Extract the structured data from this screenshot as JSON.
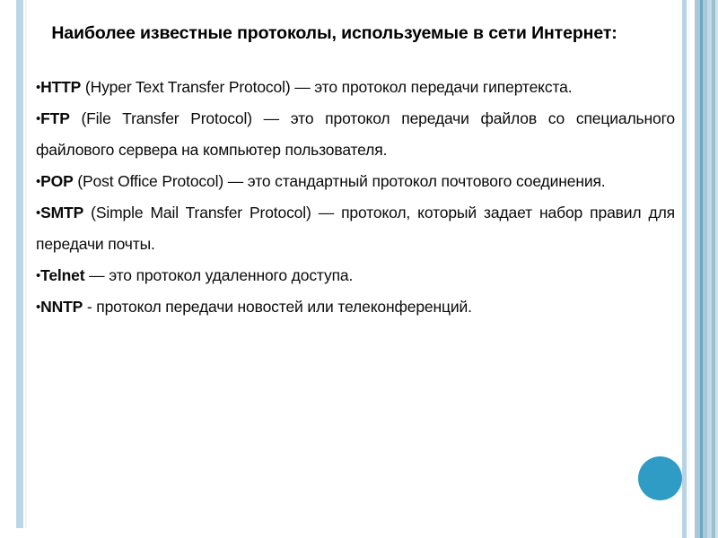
{
  "slide": {
    "title": "Наиболее известные протоколы, используемые в сети Интернет:",
    "bullet_char": "•",
    "background_color": "#ffffff",
    "decor": {
      "left_stripe_color": "#bcd6e8",
      "right_band_colors": [
        "#b9d3e2",
        "#f7fbfd",
        "#a9c7d8",
        "#6da7bf",
        "#a9c8d9",
        "#c3dae7",
        "#9dbfd2",
        "#cfe2ec"
      ],
      "circle_color": "#2e9cc4"
    }
  },
  "protocols": [
    {
      "name": "HTTP",
      "expansion": "(Hyper Text Transfer Protocol)",
      "description": " — это протокол передачи гипертекста.",
      "justify": true
    },
    {
      "name": "FTP",
      "expansion": "(File Transfer Protocol)",
      "description": " — это протокол передачи файлов со специального файлового сервера на компьютер пользователя.",
      "justify": true
    },
    {
      "name": "POP",
      "expansion": "(Post Office Protocol)",
      "description": " — это стандартный протокол почтового соединения.",
      "justify": true
    },
    {
      "name": "SMTP",
      "expansion": "(Simple Mail Transfer Protocol)",
      "description": " — протокол, который задает набор правил для передачи почты.",
      "justify": true
    },
    {
      "name": "Telnet",
      "expansion": "",
      "description": " — это протокол удаленного доступа.",
      "justify": false
    },
    {
      "name": "NNTP",
      "expansion": "",
      "description": " - протокол передачи новостей или телеконференций.",
      "justify": false
    }
  ]
}
